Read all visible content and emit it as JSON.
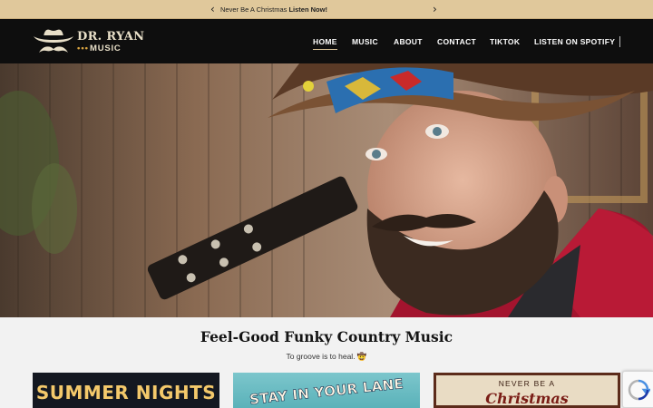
{
  "announcement": {
    "text": "Never Be A Christmas",
    "link": "Listen Now!"
  },
  "brand": {
    "line1": "DR. RYAN",
    "line2": "MUSIC"
  },
  "nav": {
    "home": "HOME",
    "music": "MUSIC",
    "about": "ABOUT",
    "contact": "CONTACT",
    "tiktok": "TIKTOK",
    "spotify": "LISTEN ON SPOTIFY"
  },
  "hero": {
    "tagline": "Feel-Good Funky Country Music",
    "subline": "To groove is to heal. 🤠"
  },
  "albums": [
    {
      "title": "SUMMER NIGHTS"
    },
    {
      "title": "STAY IN YOUR LANE"
    },
    {
      "line1": "NEVER BE A",
      "line2": "Christmas"
    }
  ],
  "colors": {
    "announce_bg": "#e0c89b",
    "header_bg": "#0e0e0e",
    "accent": "#e0c89b",
    "page_bg": "#f2f2f2"
  }
}
